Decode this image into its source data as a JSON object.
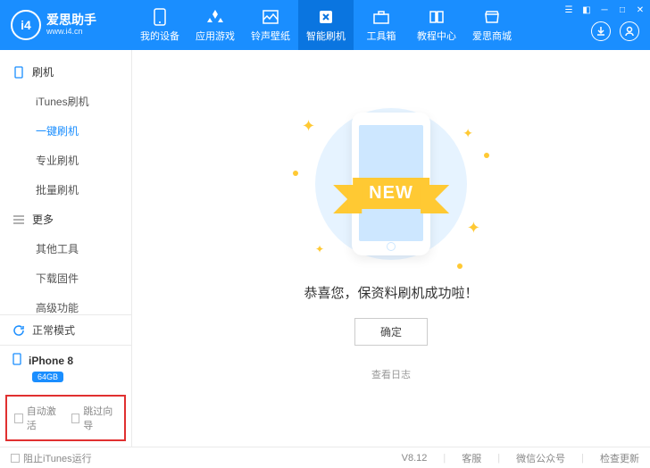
{
  "header": {
    "logo_badge": "i4",
    "title": "爱思助手",
    "sub": "www.i4.cn",
    "tabs": [
      {
        "label": "我的设备"
      },
      {
        "label": "应用游戏"
      },
      {
        "label": "铃声壁纸"
      },
      {
        "label": "智能刷机",
        "active": true
      },
      {
        "label": "工具箱"
      },
      {
        "label": "教程中心"
      },
      {
        "label": "爱思商城"
      }
    ]
  },
  "sidebar": {
    "section_flash": "刷机",
    "flash_items": [
      {
        "label": "iTunes刷机"
      },
      {
        "label": "一键刷机",
        "active": true
      },
      {
        "label": "专业刷机"
      },
      {
        "label": "批量刷机"
      }
    ],
    "section_more": "更多",
    "more_items": [
      {
        "label": "其他工具"
      },
      {
        "label": "下载固件"
      },
      {
        "label": "高级功能"
      }
    ],
    "mode": "正常模式",
    "device_name": "iPhone 8",
    "device_badge": "64GB",
    "opt_auto": "自动激活",
    "opt_skip": "跳过向导"
  },
  "main": {
    "ribbon": "NEW",
    "message": "恭喜您，保资料刷机成功啦！",
    "ok_btn": "确定",
    "log_link": "查看日志"
  },
  "footer": {
    "block_itunes": "阻止iTunes运行",
    "version": "V8.12",
    "support": "客服",
    "wechat": "微信公众号",
    "update": "检查更新"
  }
}
